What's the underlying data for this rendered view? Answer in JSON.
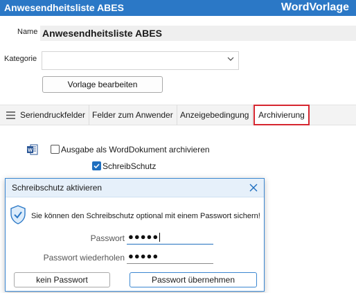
{
  "window": {
    "title": "Anwesendheitsliste ABES",
    "module": "WordVorlage",
    "accent_color": "#2b78c6"
  },
  "form": {
    "name_label": "Name",
    "name_value": "Anwesendheitsliste ABES",
    "kategorie_label": "Kategorie",
    "kategorie_value": "",
    "edit_button": "Vorlage bearbeiten"
  },
  "tabs": {
    "items": [
      {
        "label": "Seriendruckfelder"
      },
      {
        "label": "Felder zum Anwender"
      },
      {
        "label": "Anzeigebedingung"
      },
      {
        "label": "Archivierung",
        "active": true
      }
    ],
    "highlight_color": "#d6262f"
  },
  "archiv": {
    "option_archive_label": "Ausgabe als WordDokument archivieren",
    "option_archive_checked": false,
    "option_protect_label": "SchreibSchutz",
    "option_protect_checked": true
  },
  "dialog": {
    "title": "Schreibschutz aktivieren",
    "message": "Sie können den Schreibschutz optional mit einem Passwort sichern!",
    "password_label": "Passwort",
    "password_value": "●●●●●",
    "repeat_label": "Passwort wiederholen",
    "repeat_value": "●●●●●",
    "button_no_password": "kein Passwort",
    "button_accept": "Passwort übernehmen"
  }
}
